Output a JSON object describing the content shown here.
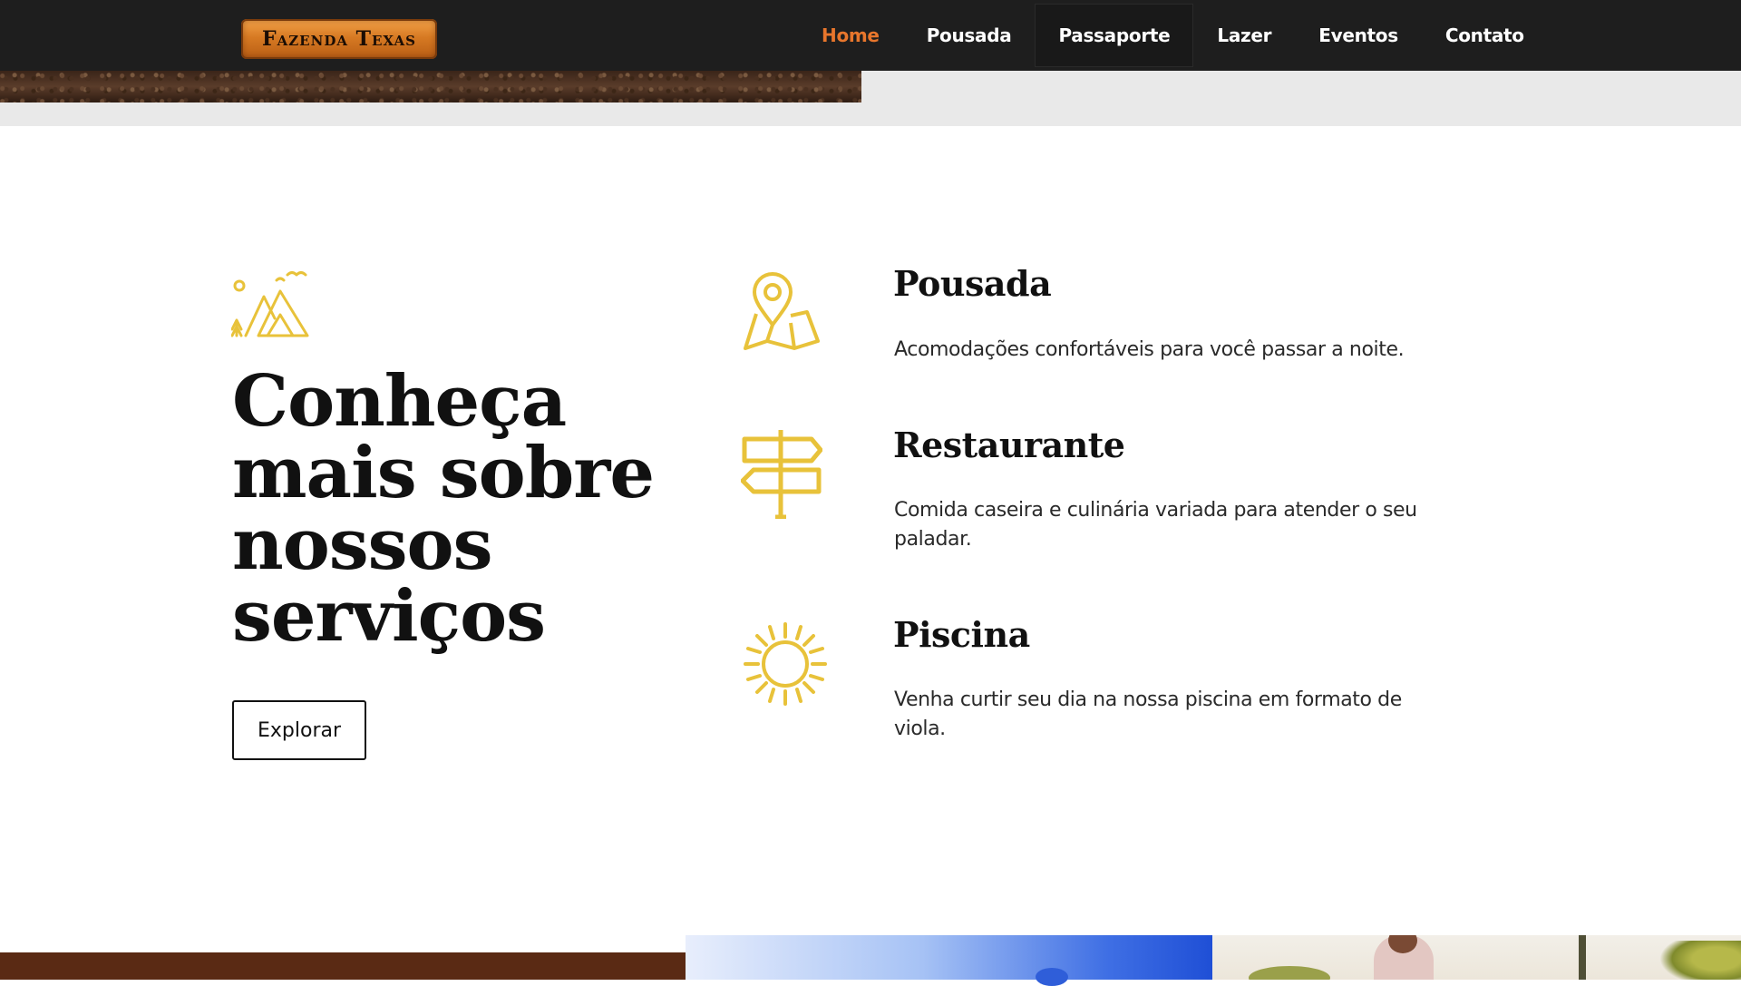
{
  "brand": {
    "logo_text": "Fazenda Texas"
  },
  "nav": {
    "items": [
      {
        "label": "Home",
        "active": true
      },
      {
        "label": "Pousada"
      },
      {
        "label": "Passaporte"
      },
      {
        "label": "Lazer"
      },
      {
        "label": "Eventos"
      },
      {
        "label": "Contato"
      }
    ]
  },
  "intro": {
    "icon": "mountains-icon",
    "heading": "Conheça mais sobre nossos serviços",
    "button_label": "Explorar"
  },
  "services": [
    {
      "icon": "map-pin-icon",
      "title": "Pousada",
      "description": "Acomodações confortáveis para você passar a noite."
    },
    {
      "icon": "signpost-icon",
      "title": "Restaurante",
      "description": "Comida caseira e culinária variada para atender o seu paladar."
    },
    {
      "icon": "sun-icon",
      "title": "Piscina",
      "description": "Venha curtir seu dia na nossa piscina em formato de viola."
    }
  ],
  "colors": {
    "header_bg": "#1e1e1e",
    "nav_active": "#e8762c",
    "icon_accent": "#e8c23a",
    "text_dark": "#111111"
  }
}
